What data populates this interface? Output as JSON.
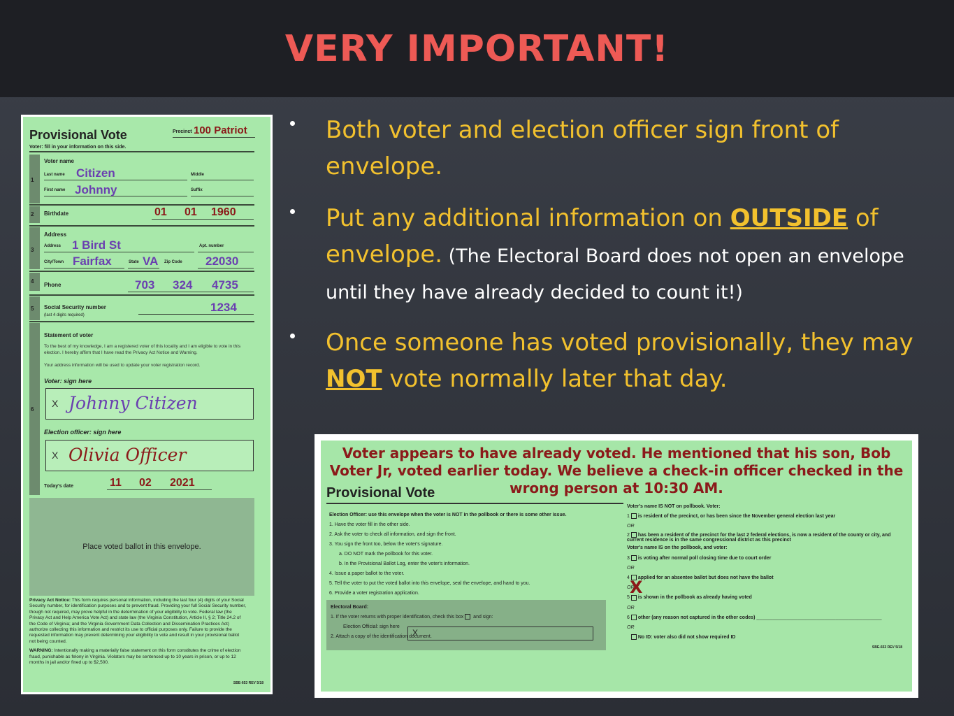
{
  "header": {
    "title": "VERY IMPORTANT!"
  },
  "bullets": {
    "b1": "Both voter and election officer sign front of envelope.",
    "b2_pre": "Put any additional information on ",
    "b2_emph": "OUTSIDE",
    "b2_post": " of envelope.",
    "b2_note": " (The Electoral Board does not open an envelope until they have already decided to count it!)",
    "b3_pre": "Once someone has voted provisionally, they may ",
    "b3_emph": "NOT",
    "b3_post": " vote normally later that day."
  },
  "envelope_front": {
    "title": "Provisional Vote",
    "subtitle": "Voter: fill in your information on this side.",
    "precinct_label": "Precinct",
    "precinct_value": "100 Patriot",
    "voter_name_label": "Voter name",
    "last_name_label": "Last name",
    "last_name": "Citizen",
    "middle_label": "Middle",
    "first_name_label": "First name",
    "first_name": "Johnny",
    "suffix_label": "Suffix",
    "birthdate_label": "Birthdate",
    "birth_month": "01",
    "birth_day": "01",
    "birth_year": "1960",
    "address_label": "Address",
    "address_sub_label": "Address",
    "address": "1 Bird St",
    "apt_label": "Apt. number",
    "city_label": "City/Town",
    "city": "Fairfax",
    "state_label": "State",
    "state": "VA",
    "zip_label": "Zip Code",
    "zip": "22030",
    "phone_label": "Phone",
    "phone_area": "703",
    "phone_prefix": "324",
    "phone_line": "4735",
    "ssn_label": "Social Security number",
    "ssn_sub": "(last 4 digits required)",
    "ssn_last4": "1234",
    "statement_label": "Statement of voter",
    "statement_text": "To the best of my knowledge, I am a registered voter of this locality and I am eligible to vote in this election. I hereby affirm that I have read the Privacy Act Notice and Warning.",
    "statement_text2": "Your address information will be used to update your voter registration record.",
    "voter_sign_label": "Voter: sign here",
    "voter_signature": "Johnny Citizen",
    "officer_sign_label": "Election officer: sign here",
    "officer_signature": "Olivia Officer",
    "todays_date_label": "Today's date",
    "date_month": "11",
    "date_day": "02",
    "date_year": "2021",
    "ballot_text": "Place voted ballot in this envelope.",
    "privacy_notice_label": "Privacy Act Notice:",
    "privacy_notice": "This form requires personal information, including the last four (4) digits of your Social Security number, for identification purposes and to prevent fraud. Providing your full Social Security number, though not required, may prove helpful in the determination of your eligibility to vote. Federal law (the Privacy Act and Help America Vote Act) and state law (the Virginia Constitution, Article II, § 2; Title 24.2 of the Code of Virginia; and the Virginia Government Data Collection and Dissemination Practices Act) authorize collecting this information and restrict its use to official purposes only. Failure to provide the requested information may prevent determining your eligibility to vote and result in your provisional ballot not being counted.",
    "warning_label": "WARNING:",
    "warning": "Intentionally making a materially false statement on this form constitutes the crime of election fraud, punishable as felony in Virginia. Violators may be sentenced up to 10 years in prison, or up to 12 months in jail and/or fined up to $2,500.",
    "rev": "SBE-653 REV 5/18",
    "section_numbers": [
      "1",
      "2",
      "3",
      "4",
      "5",
      "6"
    ],
    "sig_x": "X"
  },
  "envelope_back": {
    "note": "Voter appears to have already voted. He mentioned that his son, Bob Voter Jr, voted earlier today. We believe a check-in officer checked in the wrong person at 10:30 AM.",
    "title": "Provisional Vote",
    "instructions_header": "Election Officer: use this envelope when the voter is NOT in the pollbook or there is some other issue.",
    "steps": [
      "1.  Have the voter fill in the other side.",
      "2.  Ask the voter to check all information, and sign the front.",
      "3.  You sign the front too, below the voter's signature.",
      "a. DO NOT mark the pollbook for this voter.",
      "b. In the Provisional Ballot Log, enter the voter's information.",
      "4.  Issue a paper ballot to the voter.",
      "5.  Tell the voter to put the voted ballot into this envelope, seal the envelope, and hand to you.",
      "6.  Provide a voter registration application."
    ],
    "eboard_label": "Electoral Board:",
    "eboard_step1": "1.  If the voter returns with proper identification, check this box",
    "eboard_step1_end": "and sign:",
    "eboard_official": "Election Official: sign here",
    "eboard_x": "X",
    "eboard_step2": "2.  Attach a copy of the identification document.",
    "not_on_pollbook": "Voter's name IS NOT on pollbook. Voter:",
    "opt1": "is resident of the precinct, or has been since the November general election last year",
    "opt2": "has been a resident of the precinct for the last 2 federal elections, is now a resident of the county or city, and current residence is in the same congressional district as this precinct",
    "is_on_pollbook": "Voter's name IS on the pollbook, and voter:",
    "opt3": "is voting after normal poll closing time due to court order",
    "opt4": "applied for an absentee ballot but does not have the ballot",
    "opt5": "is shown in the pollbook as already having voted",
    "opt6": "other (any reason not captured in the other codes)",
    "opt_noid": "No ID: voter also did not show required ID",
    "or_text": "OR",
    "mark": "X",
    "rev": "SBE-653 REV 5/18"
  }
}
